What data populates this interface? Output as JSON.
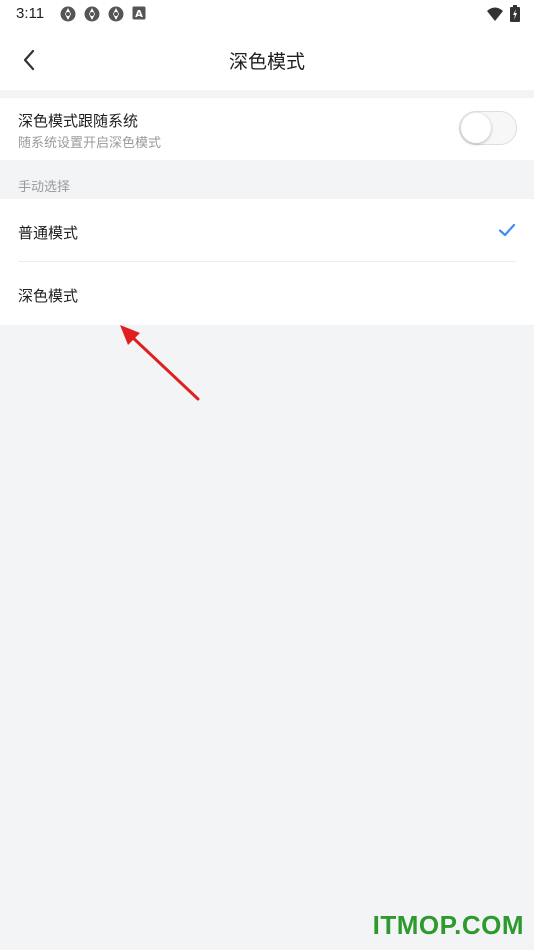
{
  "status_bar": {
    "time": "3:11",
    "notification_icons": [
      "aperture-icon",
      "aperture-icon",
      "aperture-icon",
      "a-box-icon"
    ],
    "right_icons": [
      "wifi-icon",
      "battery-charging-icon"
    ]
  },
  "header": {
    "back_icon": "chevron-left-icon",
    "title": "深色模式"
  },
  "follow_system": {
    "title": "深色模式跟随系统",
    "subtitle": "随系统设置开启深色模式",
    "toggle_on": false
  },
  "manual": {
    "section_label": "手动选择",
    "options": [
      {
        "label": "普通模式",
        "selected": true
      },
      {
        "label": "深色模式",
        "selected": false
      }
    ]
  },
  "watermark": "ITMOP.COM",
  "colors": {
    "accent_check": "#3d8ff0",
    "background": "#f3f4f6",
    "annotation_arrow": "#e02020",
    "watermark": "#2d9a2d"
  }
}
